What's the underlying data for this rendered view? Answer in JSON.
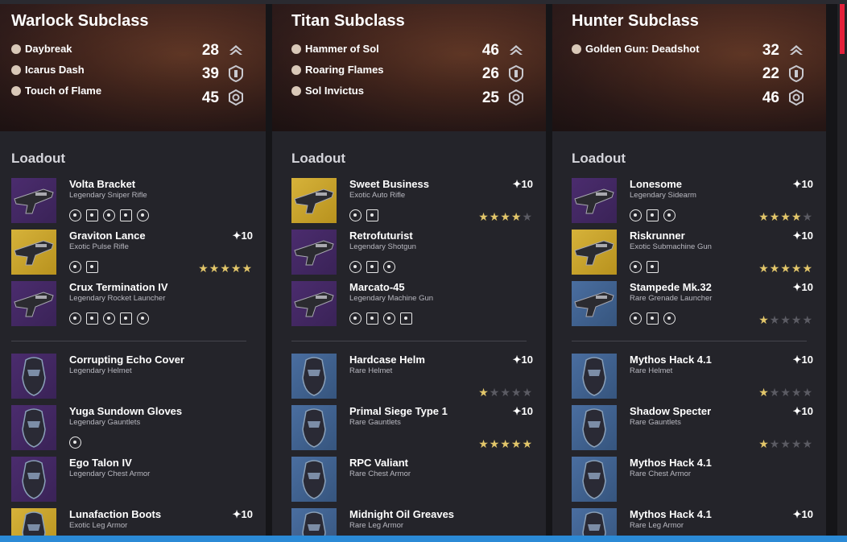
{
  "colors": {
    "accent_star": "#e2c66a",
    "scroll_accent": "#e4203a",
    "bottom_bar": "#2b8ad6"
  },
  "columns": [
    {
      "title": "Warlock Subclass",
      "abilities": [
        {
          "label": "Daybreak",
          "icon": "solar-super-icon"
        },
        {
          "label": "Icarus Dash",
          "icon": "dash-icon"
        },
        {
          "label": "Touch of Flame",
          "icon": "grenade-icon"
        }
      ],
      "stats": [
        {
          "value": "28",
          "icon": "mobility-icon"
        },
        {
          "value": "39",
          "icon": "resilience-icon"
        },
        {
          "value": "45",
          "icon": "recovery-icon"
        }
      ],
      "loadout_label": "Loadout",
      "weapons": [
        {
          "name": "Volta Bracket",
          "type": "Legendary Sniper Rifle",
          "power": "",
          "thumb": "purple",
          "perks": 5,
          "stars": 0
        },
        {
          "name": "Graviton Lance",
          "type": "Exotic Pulse Rifle",
          "power": "✦10",
          "thumb": "gold",
          "perks": 2,
          "stars": 5
        },
        {
          "name": "Crux Termination IV",
          "type": "Legendary Rocket Launcher",
          "power": "",
          "thumb": "purple",
          "perks": 5,
          "stars": 0
        }
      ],
      "armor": [
        {
          "name": "Corrupting Echo Cover",
          "type": "Legendary Helmet",
          "power": "",
          "thumb": "purple",
          "perks": 0,
          "stars": 0
        },
        {
          "name": "Yuga Sundown Gloves",
          "type": "Legendary Gauntlets",
          "power": "",
          "thumb": "purple",
          "perks": 1,
          "stars": 0
        },
        {
          "name": "Ego Talon IV",
          "type": "Legendary Chest Armor",
          "power": "",
          "thumb": "purple",
          "perks": 0,
          "stars": 0
        },
        {
          "name": "Lunafaction Boots",
          "type": "Exotic Leg Armor",
          "power": "✦10",
          "thumb": "gold",
          "perks": 0,
          "stars": 0
        }
      ]
    },
    {
      "title": "Titan Subclass",
      "abilities": [
        {
          "label": "Hammer of Sol",
          "icon": "solar-super-icon"
        },
        {
          "label": "Roaring Flames",
          "icon": "aspect-icon"
        },
        {
          "label": "Sol Invictus",
          "icon": "aspect-icon"
        }
      ],
      "stats": [
        {
          "value": "46",
          "icon": "mobility-icon"
        },
        {
          "value": "26",
          "icon": "resilience-icon"
        },
        {
          "value": "25",
          "icon": "recovery-icon"
        }
      ],
      "loadout_label": "Loadout",
      "weapons": [
        {
          "name": "Sweet Business",
          "type": "Exotic Auto Rifle",
          "power": "✦10",
          "thumb": "gold",
          "perks": 2,
          "stars": 3.5
        },
        {
          "name": "Retrofuturist",
          "type": "Legendary Shotgun",
          "power": "",
          "thumb": "purple",
          "perks": 3,
          "stars": 0
        },
        {
          "name": "Marcato-45",
          "type": "Legendary Machine Gun",
          "power": "",
          "thumb": "purple",
          "perks": 4,
          "stars": 0
        }
      ],
      "armor": [
        {
          "name": "Hardcase Helm",
          "type": "Rare Helmet",
          "power": "✦10",
          "thumb": "blue",
          "perks": 0,
          "stars": 1
        },
        {
          "name": "Primal Siege Type 1",
          "type": "Rare Gauntlets",
          "power": "✦10",
          "thumb": "blue",
          "perks": 0,
          "stars": 5
        },
        {
          "name": "RPC Valiant",
          "type": "Rare Chest Armor",
          "power": "",
          "thumb": "blue",
          "perks": 0,
          "stars": 0
        },
        {
          "name": "Midnight Oil Greaves",
          "type": "Rare Leg Armor",
          "power": "",
          "thumb": "blue",
          "perks": 0,
          "stars": 0
        }
      ]
    },
    {
      "title": "Hunter Subclass",
      "abilities": [
        {
          "label": "Golden Gun: Deadshot",
          "icon": "solar-super-icon"
        }
      ],
      "stats": [
        {
          "value": "32",
          "icon": "mobility-icon"
        },
        {
          "value": "22",
          "icon": "resilience-icon"
        },
        {
          "value": "46",
          "icon": "recovery-icon"
        }
      ],
      "loadout_label": "Loadout",
      "weapons": [
        {
          "name": "Lonesome",
          "type": "Legendary Sidearm",
          "power": "✦10",
          "thumb": "purple",
          "perks": 3,
          "stars": 4
        },
        {
          "name": "Riskrunner",
          "type": "Exotic Submachine Gun",
          "power": "✦10",
          "thumb": "gold",
          "perks": 2,
          "stars": 5
        },
        {
          "name": "Stampede Mk.32",
          "type": "Rare Grenade Launcher",
          "power": "✦10",
          "thumb": "blue",
          "perks": 3,
          "stars": 1
        }
      ],
      "armor": [
        {
          "name": "Mythos Hack 4.1",
          "type": "Rare Helmet",
          "power": "✦10",
          "thumb": "blue",
          "perks": 0,
          "stars": 1
        },
        {
          "name": "Shadow Specter",
          "type": "Rare Gauntlets",
          "power": "✦10",
          "thumb": "blue",
          "perks": 0,
          "stars": 1
        },
        {
          "name": "Mythos Hack 4.1",
          "type": "Rare Chest Armor",
          "power": "",
          "thumb": "blue",
          "perks": 0,
          "stars": 0
        },
        {
          "name": "Mythos Hack 4.1",
          "type": "Rare Leg Armor",
          "power": "✦10",
          "thumb": "blue",
          "perks": 0,
          "stars": 0
        }
      ]
    }
  ]
}
